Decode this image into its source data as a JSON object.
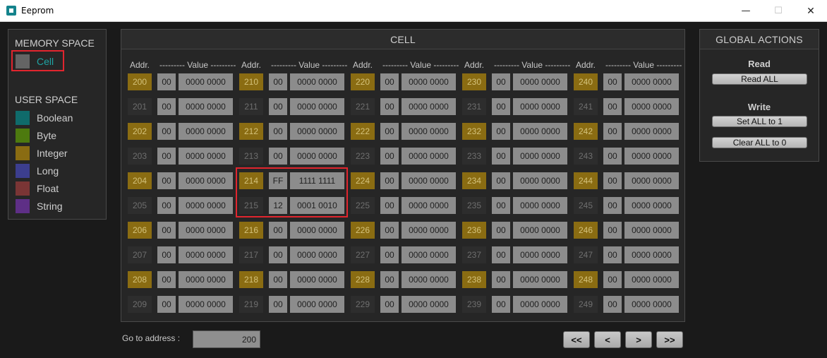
{
  "window": {
    "title": "Eeprom",
    "min": "—",
    "max": "☐",
    "close": "✕"
  },
  "memory_space": {
    "header": "MEMORY SPACE",
    "cell_label": "Cell",
    "cell_color": "#646464",
    "user_space_header": "USER SPACE",
    "types": [
      {
        "label": "Boolean",
        "color": "#0f6b6b"
      },
      {
        "label": "Byte",
        "color": "#4d7a0f"
      },
      {
        "label": "Integer",
        "color": "#8a6c12"
      },
      {
        "label": "Long",
        "color": "#3c3e8e"
      },
      {
        "label": "Float",
        "color": "#7a3535"
      },
      {
        "label": "String",
        "color": "#5e2f86"
      }
    ]
  },
  "cell_panel": {
    "title": "CELL",
    "addr_header": "Addr.",
    "value_header": "--------- Value ---------",
    "columns": [
      [
        {
          "addr": "200",
          "hex": "00",
          "bin": "0000 0000"
        },
        {
          "addr": "201",
          "hex": "00",
          "bin": "0000 0000"
        },
        {
          "addr": "202",
          "hex": "00",
          "bin": "0000 0000"
        },
        {
          "addr": "203",
          "hex": "00",
          "bin": "0000 0000"
        },
        {
          "addr": "204",
          "hex": "00",
          "bin": "0000 0000"
        },
        {
          "addr": "205",
          "hex": "00",
          "bin": "0000 0000"
        },
        {
          "addr": "206",
          "hex": "00",
          "bin": "0000 0000"
        },
        {
          "addr": "207",
          "hex": "00",
          "bin": "0000 0000"
        },
        {
          "addr": "208",
          "hex": "00",
          "bin": "0000 0000"
        },
        {
          "addr": "209",
          "hex": "00",
          "bin": "0000 0000"
        }
      ],
      [
        {
          "addr": "210",
          "hex": "00",
          "bin": "0000 0000"
        },
        {
          "addr": "211",
          "hex": "00",
          "bin": "0000 0000"
        },
        {
          "addr": "212",
          "hex": "00",
          "bin": "0000 0000"
        },
        {
          "addr": "213",
          "hex": "00",
          "bin": "0000 0000"
        },
        {
          "addr": "214",
          "hex": "FF",
          "bin": "1111 1111"
        },
        {
          "addr": "215",
          "hex": "12",
          "bin": "0001 0010"
        },
        {
          "addr": "216",
          "hex": "00",
          "bin": "0000 0000"
        },
        {
          "addr": "217",
          "hex": "00",
          "bin": "0000 0000"
        },
        {
          "addr": "218",
          "hex": "00",
          "bin": "0000 0000"
        },
        {
          "addr": "219",
          "hex": "00",
          "bin": "0000 0000"
        }
      ],
      [
        {
          "addr": "220",
          "hex": "00",
          "bin": "0000 0000"
        },
        {
          "addr": "221",
          "hex": "00",
          "bin": "0000 0000"
        },
        {
          "addr": "222",
          "hex": "00",
          "bin": "0000 0000"
        },
        {
          "addr": "223",
          "hex": "00",
          "bin": "0000 0000"
        },
        {
          "addr": "224",
          "hex": "00",
          "bin": "0000 0000"
        },
        {
          "addr": "225",
          "hex": "00",
          "bin": "0000 0000"
        },
        {
          "addr": "226",
          "hex": "00",
          "bin": "0000 0000"
        },
        {
          "addr": "227",
          "hex": "00",
          "bin": "0000 0000"
        },
        {
          "addr": "228",
          "hex": "00",
          "bin": "0000 0000"
        },
        {
          "addr": "229",
          "hex": "00",
          "bin": "0000 0000"
        }
      ],
      [
        {
          "addr": "230",
          "hex": "00",
          "bin": "0000 0000"
        },
        {
          "addr": "231",
          "hex": "00",
          "bin": "0000 0000"
        },
        {
          "addr": "232",
          "hex": "00",
          "bin": "0000 0000"
        },
        {
          "addr": "233",
          "hex": "00",
          "bin": "0000 0000"
        },
        {
          "addr": "234",
          "hex": "00",
          "bin": "0000 0000"
        },
        {
          "addr": "235",
          "hex": "00",
          "bin": "0000 0000"
        },
        {
          "addr": "236",
          "hex": "00",
          "bin": "0000 0000"
        },
        {
          "addr": "237",
          "hex": "00",
          "bin": "0000 0000"
        },
        {
          "addr": "238",
          "hex": "00",
          "bin": "0000 0000"
        },
        {
          "addr": "239",
          "hex": "00",
          "bin": "0000 0000"
        }
      ],
      [
        {
          "addr": "240",
          "hex": "00",
          "bin": "0000 0000"
        },
        {
          "addr": "241",
          "hex": "00",
          "bin": "0000 0000"
        },
        {
          "addr": "242",
          "hex": "00",
          "bin": "0000 0000"
        },
        {
          "addr": "243",
          "hex": "00",
          "bin": "0000 0000"
        },
        {
          "addr": "244",
          "hex": "00",
          "bin": "0000 0000"
        },
        {
          "addr": "245",
          "hex": "00",
          "bin": "0000 0000"
        },
        {
          "addr": "246",
          "hex": "00",
          "bin": "0000 0000"
        },
        {
          "addr": "247",
          "hex": "00",
          "bin": "0000 0000"
        },
        {
          "addr": "248",
          "hex": "00",
          "bin": "0000 0000"
        },
        {
          "addr": "249",
          "hex": "00",
          "bin": "0000 0000"
        }
      ]
    ]
  },
  "global_actions": {
    "title": "GLOBAL ACTIONS",
    "read_header": "Read",
    "read_all": "Read ALL",
    "write_header": "Write",
    "set_all": "Set ALL to 1",
    "clear_all": "Clear ALL to 0"
  },
  "navigation": {
    "goto_label": "Go to address :",
    "goto_value": "200",
    "first": "<<",
    "prev": "<",
    "next": ">",
    "last": ">>"
  }
}
